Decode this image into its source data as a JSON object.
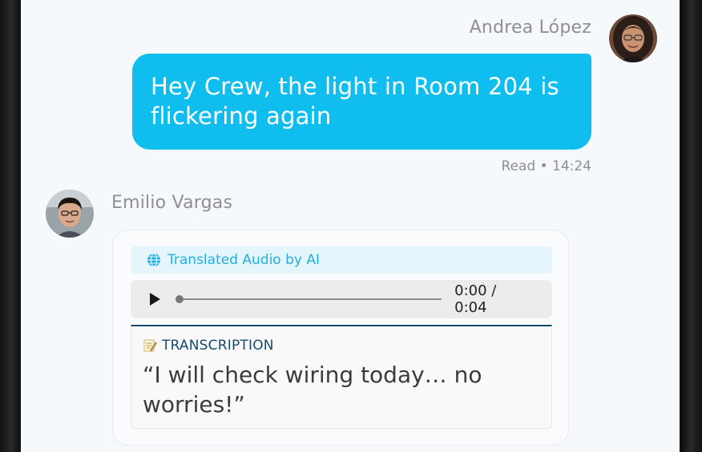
{
  "conversation": {
    "outgoing": {
      "sender_name": "Andrea López",
      "text": "Hey Crew, the light in Room 204 is flickering again",
      "receipt": "Read • 14:24",
      "bubble_color": "#0fbdef"
    },
    "incoming": {
      "sender_name": "Emilio Vargas",
      "ai_banner_label": "Translated Audio by AI",
      "ai_banner_icon": "globe-icon",
      "audio": {
        "play_icon": "play-icon",
        "time_display": "0:00 / 0:04",
        "progress": 0
      },
      "transcription": {
        "label_icon": "memo-icon",
        "label": "TRANSCRIPTION",
        "text": "“I will check wiring today… no worries!”"
      }
    }
  }
}
